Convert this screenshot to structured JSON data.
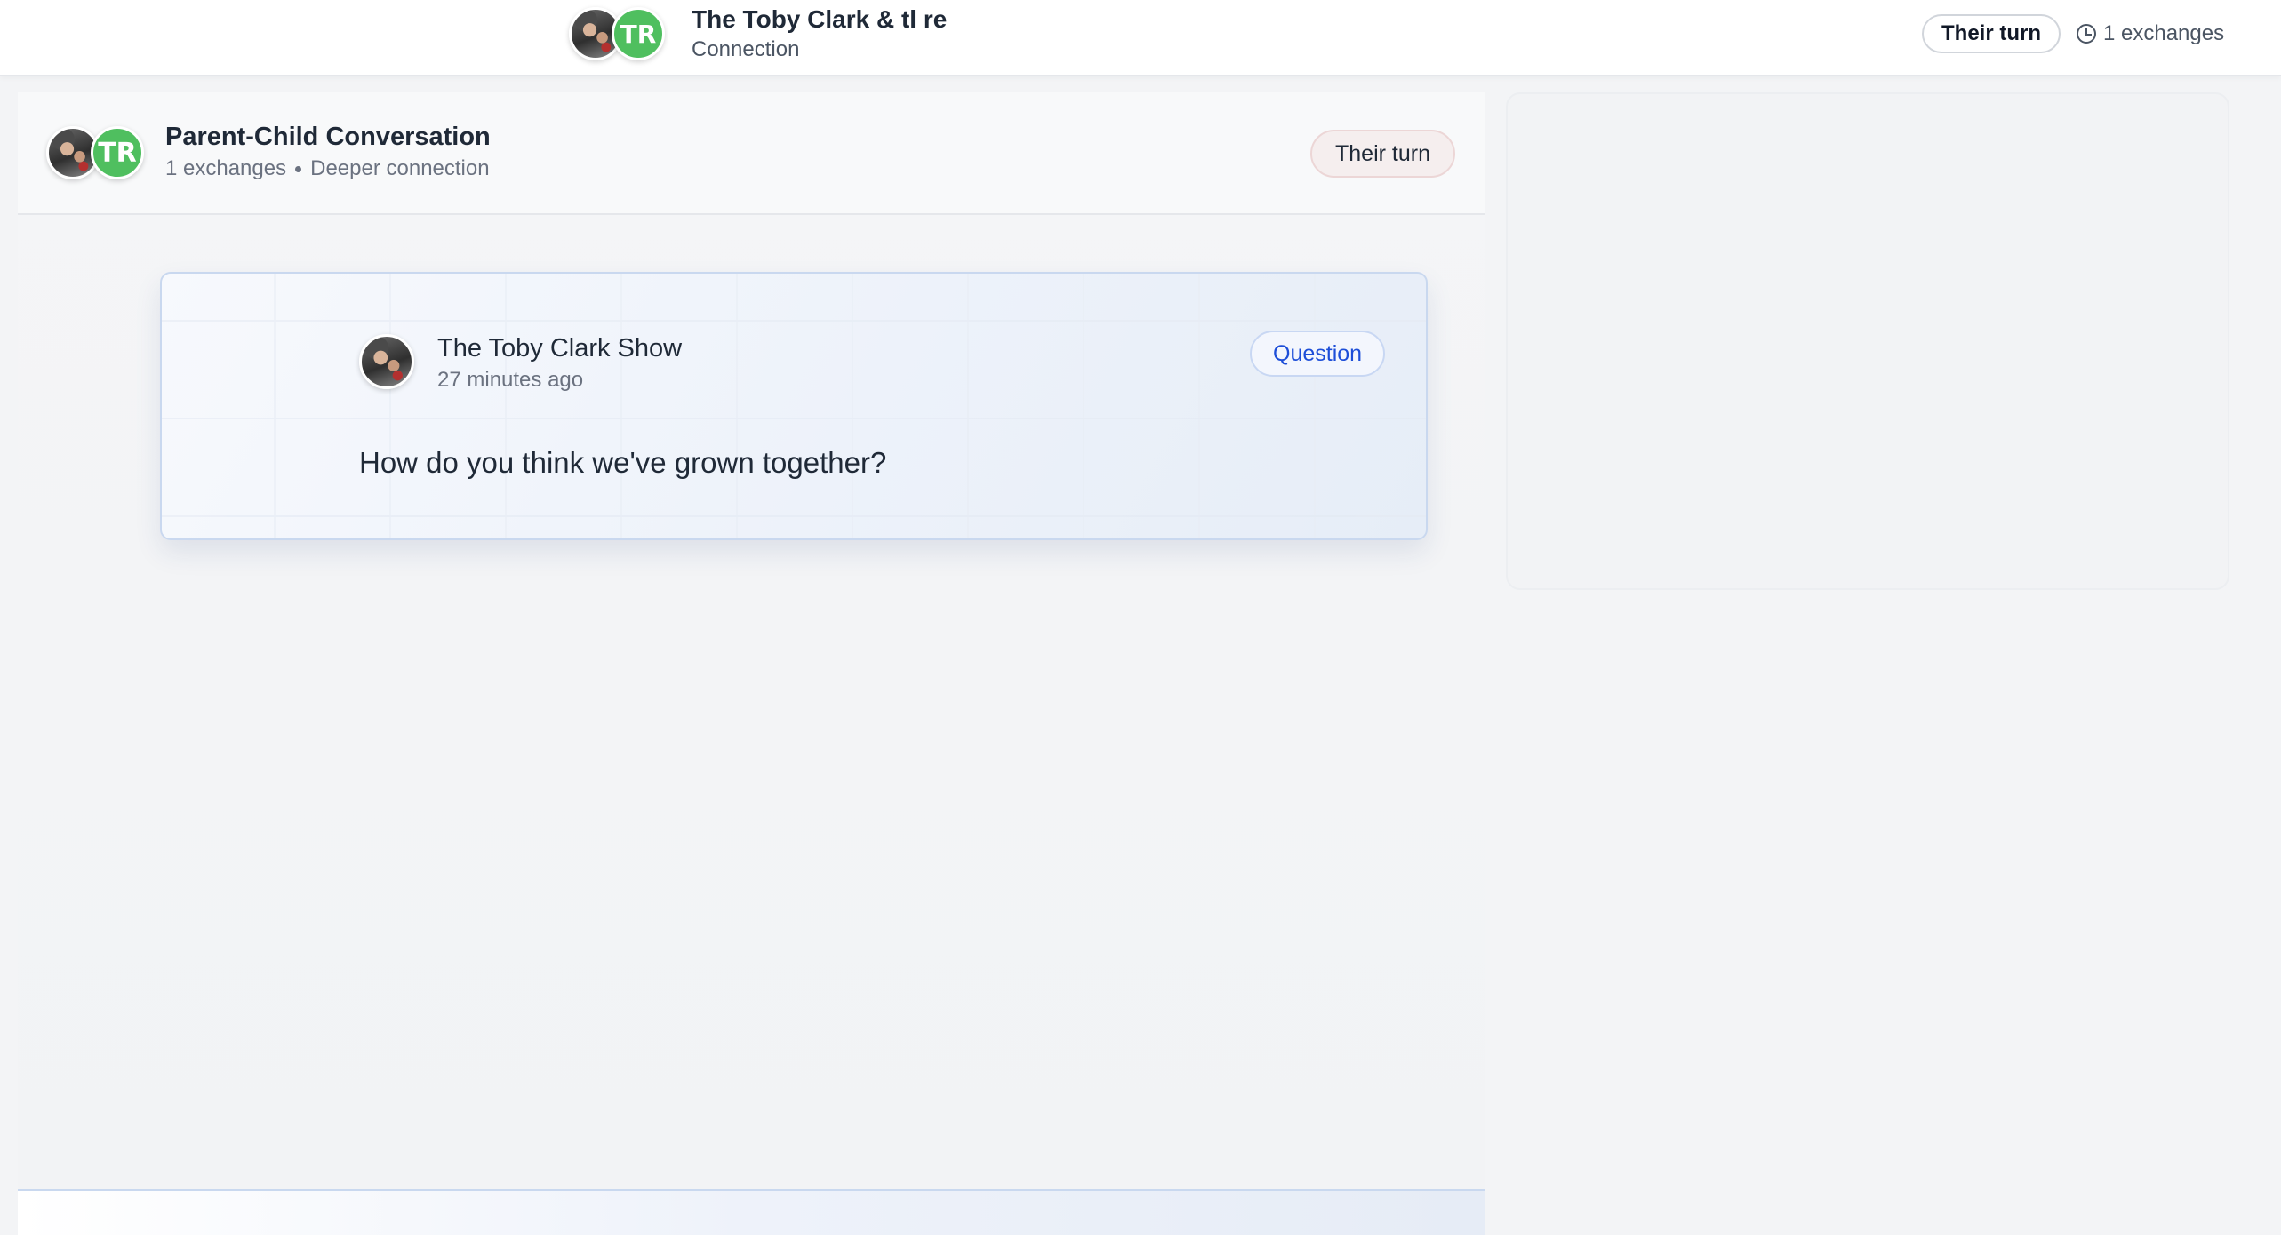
{
  "header": {
    "title": "The Toby Clark & tl re",
    "subtitle": "Connection",
    "initials": "TR",
    "turn_label": "Their turn",
    "exchanges": "1 exchanges"
  },
  "conversation": {
    "title": "Parent-Child Conversation",
    "initials": "TR",
    "meta_exchanges": "1 exchanges",
    "meta_type": "Deeper connection",
    "turn_label": "Their turn"
  },
  "message": {
    "author": "The Toby Clark Show",
    "time": "27 minutes ago",
    "badge": "Question",
    "text": "How do you think we've grown together?"
  },
  "colors": {
    "initials_avatar": "#4fbf5f",
    "question_badge_text": "#1d4ed8",
    "their_turn_bg": "#f5eeee"
  }
}
